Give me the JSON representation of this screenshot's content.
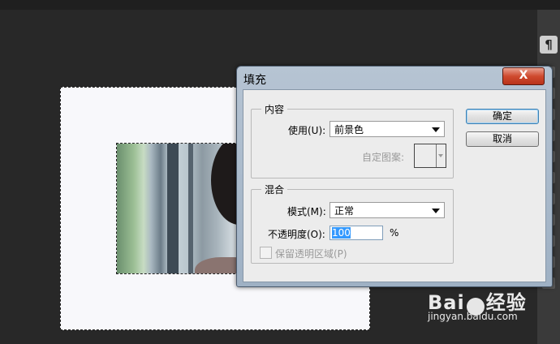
{
  "app": {
    "tool_glyph": "¶"
  },
  "dialog": {
    "title": "填充",
    "close_label": "X",
    "content_group": {
      "legend": "内容",
      "use_label": "使用(U):",
      "use_value": "前景色",
      "pattern_label": "自定图案:"
    },
    "blend_group": {
      "legend": "混合",
      "mode_label": "模式(M):",
      "mode_value": "正常",
      "opacity_label": "不透明度(O):",
      "opacity_value": "100",
      "opacity_unit": "%",
      "preserve_label": "保留透明区域(P)",
      "preserve_checked": false
    },
    "ok_label": "确定",
    "cancel_label": "取消"
  },
  "watermark": {
    "logo_text_left": "Bai",
    "logo_text_right": "经验",
    "url": "jingyan.baidu.com"
  }
}
